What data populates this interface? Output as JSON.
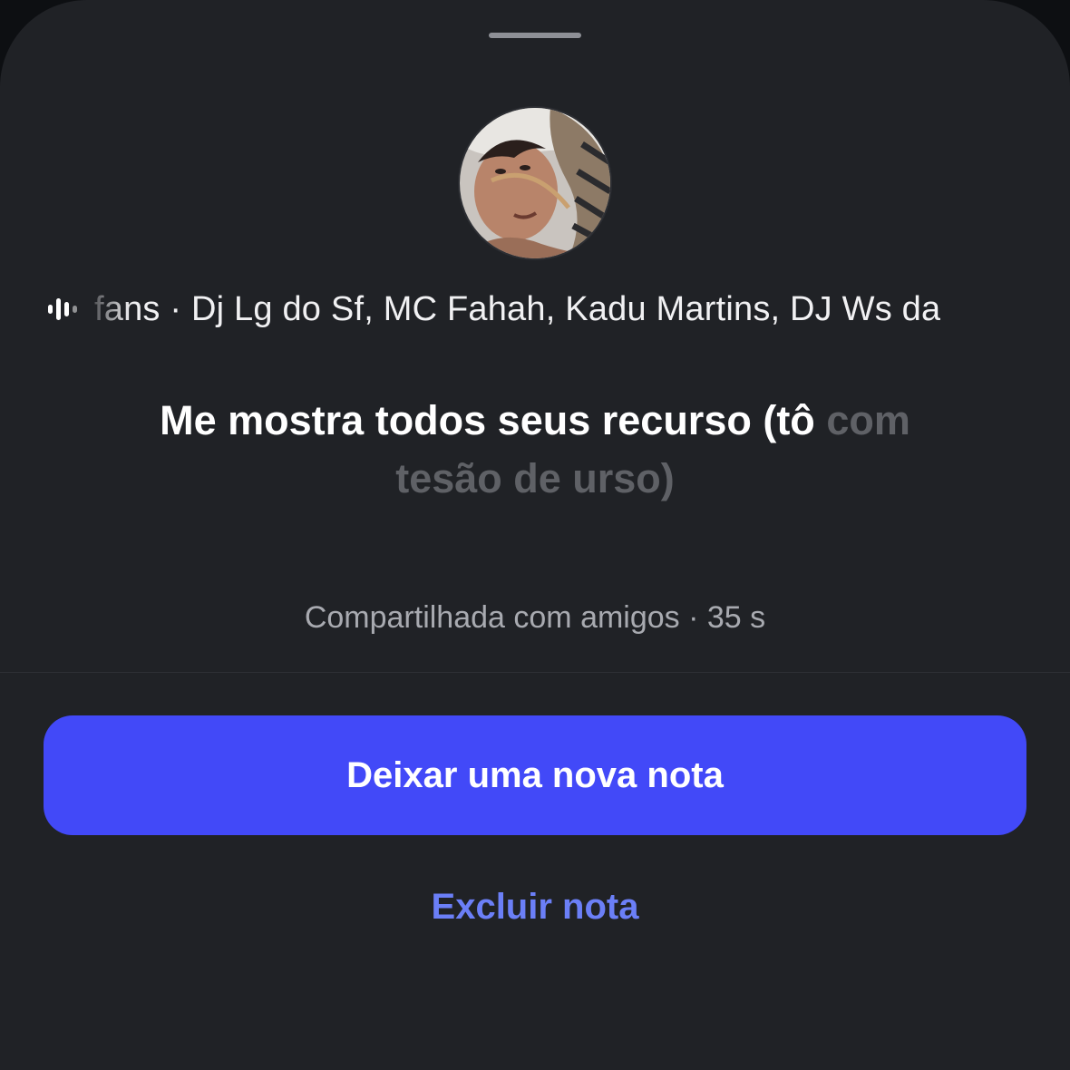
{
  "sheet": {
    "music": {
      "icon": "audio-waveform-icon",
      "track_visible": "fans",
      "artists_line": " · Dj Lg do Sf, MC Fahah, Kadu Martins, DJ Ws da"
    },
    "note": {
      "text_bright": "Me mostra todos seus recurso (tô",
      "text_dim": " com tesão de urso)"
    },
    "shared_status": "Compartilhada com amigos · 35 s",
    "primary_action_label": "Deixar uma nova nota",
    "delete_action_label": "Excluir nota"
  },
  "colors": {
    "sheet_background": "#202226",
    "primary_button": "#4249f8",
    "link": "#6b7ff7",
    "secondary_text": "#a8aab0"
  }
}
